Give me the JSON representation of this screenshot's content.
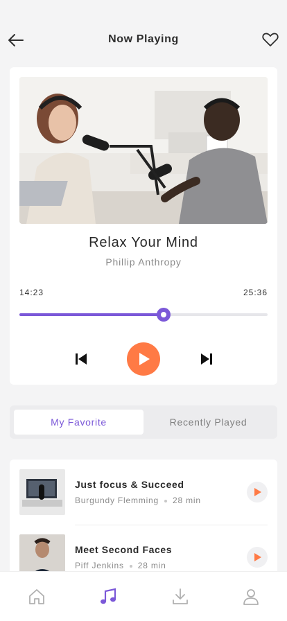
{
  "header": {
    "title": "Now Playing",
    "back_icon": "arrow-left-icon",
    "favorite_icon": "heart-outline-icon"
  },
  "player": {
    "track_title": "Relax Your Mind",
    "artist": "Phillip Anthropy",
    "current_time": "14:23",
    "total_time": "25:36",
    "progress_fraction": 0.58,
    "controls": {
      "prev_icon": "skip-previous-icon",
      "play_icon": "play-icon",
      "next_icon": "skip-next-icon"
    }
  },
  "tabs": [
    {
      "label": "My Favorite",
      "active": true
    },
    {
      "label": "Recently Played",
      "active": false
    }
  ],
  "list": [
    {
      "title": "Just focus & Succeed",
      "author": "Burgundy Flemming",
      "duration": "28 min"
    },
    {
      "title": "Meet Second Faces",
      "author": "Piff Jenkins",
      "duration": "28 min"
    }
  ],
  "bottom_nav": [
    {
      "icon": "home-icon",
      "active": false
    },
    {
      "icon": "music-note-icon",
      "active": true
    },
    {
      "icon": "download-icon",
      "active": false
    },
    {
      "icon": "profile-icon",
      "active": false
    }
  ],
  "colors": {
    "accent": "#7b58d8",
    "play": "#ff7a45",
    "background": "#f4f4f5"
  }
}
